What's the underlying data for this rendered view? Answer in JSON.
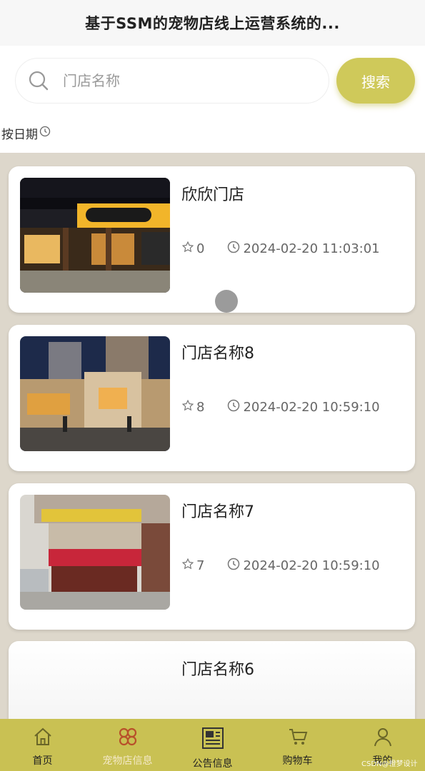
{
  "header": {
    "title": "基于SSM的宠物店线上运营系统的..."
  },
  "search": {
    "placeholder": "门店名称",
    "button_label": "搜索"
  },
  "sort": {
    "label": "按日期"
  },
  "stores": [
    {
      "name": "欣欣门店",
      "count": "0",
      "date": "2024-02-20 11:03:01"
    },
    {
      "name": "门店名称8",
      "count": "8",
      "date": "2024-02-20 10:59:10"
    },
    {
      "name": "门店名称7",
      "count": "7",
      "date": "2024-02-20 10:59:10"
    },
    {
      "name": "门店名称6",
      "count": "",
      "date": ""
    }
  ],
  "tabbar": {
    "items": [
      {
        "label": "首页",
        "icon": "home-icon"
      },
      {
        "label": "宠物店信息",
        "icon": "shop-grid-icon"
      },
      {
        "label": "公告信息",
        "icon": "notice-icon"
      },
      {
        "label": "购物车",
        "icon": "cart-icon"
      },
      {
        "label": "我的",
        "icon": "user-icon"
      }
    ],
    "active_index": 1
  },
  "watermark": "CSDN@橙梦设计",
  "colors": {
    "accent": "#cfc95a",
    "tabbar": "#c9c153",
    "active_tab": "#b8502a",
    "background": "#ddd7cb"
  }
}
